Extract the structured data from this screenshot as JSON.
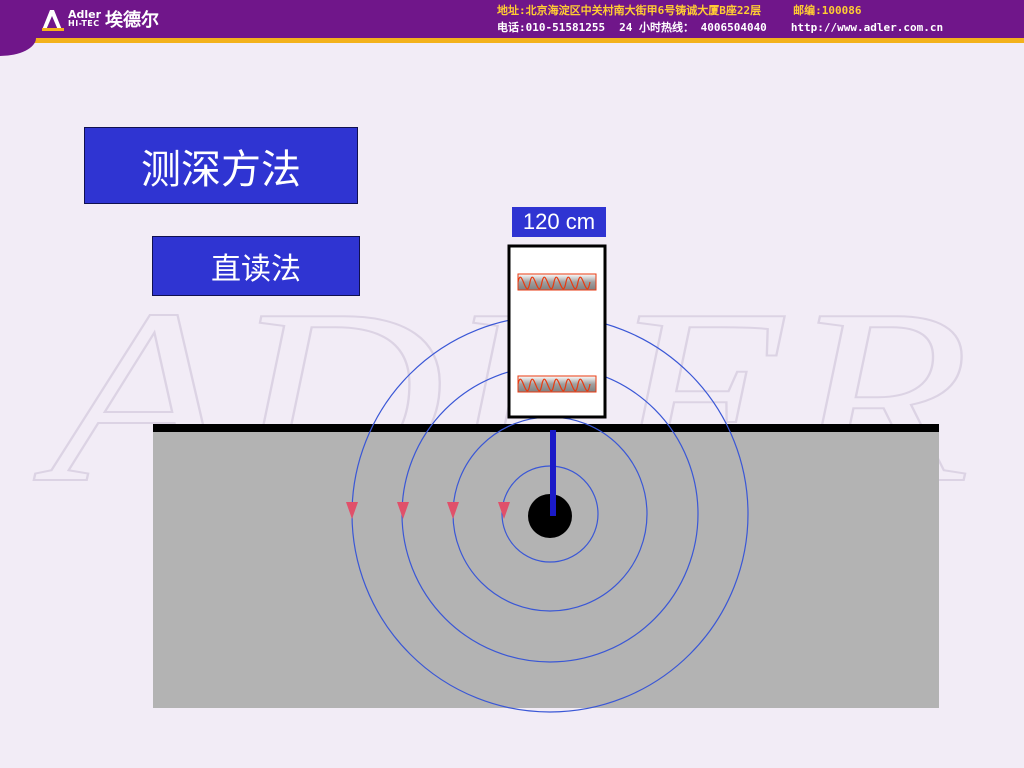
{
  "header": {
    "logo_brand_top": "Adler",
    "logo_brand_bottom": "HI-TEC",
    "logo_cn": "埃德尔",
    "address": "地址:北京海淀区中关村南大街甲6号铸诚大厦B座22层",
    "postcode": "邮编:100086",
    "phone": "电话:010-51581255",
    "hotline": "24 小时热线： 4006504040",
    "url": "http://www.adler.com.cn"
  },
  "watermark": {
    "text": "ADLER"
  },
  "slide": {
    "title": "测深方法",
    "method": "直读法",
    "distance_label": "120 cm"
  },
  "colors": {
    "header_bg": "#70168a",
    "header_stripe": "#f3b21c",
    "box_blue": "#2f34d2",
    "ground": "#b3b3b3",
    "field_lines": "#3a57d6",
    "coil_wire": "#e83a10",
    "arrow": "#e0506a",
    "probe_rod": "#1a1ac8"
  },
  "icons": {
    "logo": "adler-logo-icon"
  }
}
